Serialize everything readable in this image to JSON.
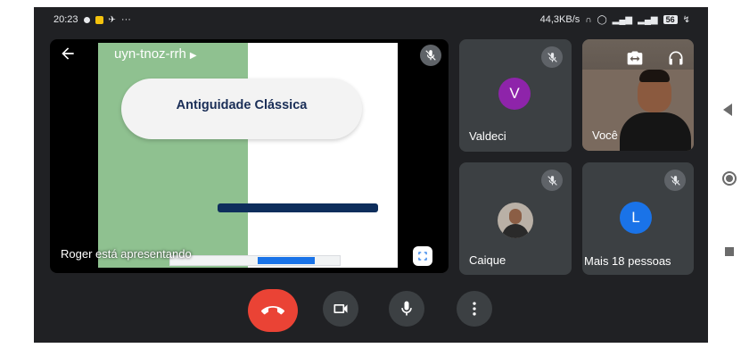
{
  "statusbar": {
    "time": "20:23",
    "more": "···",
    "net_speed": "44,3KB/s",
    "battery_label": "56"
  },
  "presentation": {
    "meeting_code": "uyn-tnoz-rrh",
    "slide_title": "Antiguidade Clássica",
    "presenting_text": "Roger está apresentando"
  },
  "participants": [
    {
      "name": "Valdeci",
      "initial": "V",
      "avatar_color": "#8e24aa",
      "muted": true
    },
    {
      "name": "Você",
      "muted": false
    },
    {
      "name": "Caique",
      "muted": true
    },
    {
      "name": "Mais 18 pessoas",
      "initial": "L",
      "avatar_color": "#1a73e8",
      "muted": true
    }
  ],
  "controls": {
    "hangup_color": "#ea4335",
    "buttons": [
      "end-call",
      "camera",
      "microphone",
      "more-options"
    ]
  },
  "colors": {
    "background": "#202124",
    "tile": "#3c4043",
    "slide_title": "#1a2e57",
    "slide_bar": "#0e2e5c"
  }
}
